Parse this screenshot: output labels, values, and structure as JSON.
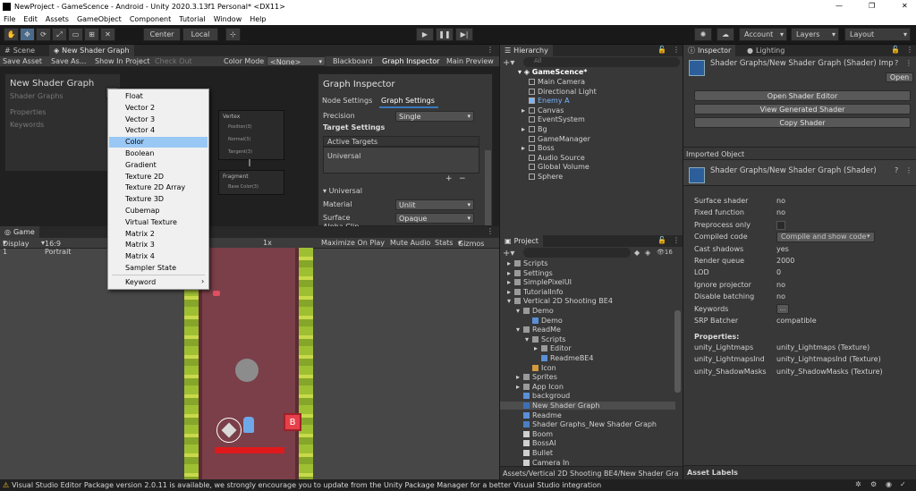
{
  "window": {
    "title": "NewProject - GameScence - Android - Unity 2020.3.13f1 Personal* <DX11>",
    "controls": [
      "—",
      "❐",
      "✕"
    ]
  },
  "menu": [
    "File",
    "Edit",
    "Assets",
    "GameObject",
    "Component",
    "Tutorial",
    "Window",
    "Help"
  ],
  "toolbar": {
    "center": "Center",
    "local": "Local",
    "account": "Account",
    "layers": "Layers",
    "layout": "Layout"
  },
  "scene_panel": {
    "tab_scene": "Scene",
    "tab_shader": "New Shader Graph",
    "subbar": {
      "save_asset": "Save Asset",
      "save_as": "Save As...",
      "show_in_project": "Show In Project",
      "check_out": "Check Out",
      "color_mode_label": "Color Mode",
      "color_mode_value": "<None>",
      "blackboard": "Blackboard",
      "graph_inspector": "Graph Inspector",
      "main_preview": "Main Preview"
    },
    "blackboard": {
      "title": "New Shader Graph",
      "subtitle": "Shader Graphs",
      "properties": "Properties",
      "keywords": "Keywords"
    },
    "nodes": {
      "vertex_title": "Vertex",
      "vertex_ports": [
        "Position(3)",
        "Normal(3)",
        "Tangent(3)"
      ],
      "fragment_title": "Fragment",
      "fragment_ports": [
        "Base Color(3)"
      ]
    },
    "graph_inspector": {
      "title": "Graph Inspector",
      "tab_node": "Node Settings",
      "tab_graph": "Graph Settings",
      "precision_label": "Precision",
      "precision_value": "Single",
      "target_settings": "Target Settings",
      "active_targets": "Active Targets",
      "universal_item": "Universal",
      "universal_section": "Universal",
      "material_label": "Material",
      "material_value": "Unlit",
      "surface_label": "Surface",
      "surface_value": "Opaque",
      "alpha_clip_label": "Alpha Clip"
    }
  },
  "context_menu": {
    "items": [
      "Float",
      "Vector 2",
      "Vector 3",
      "Vector 4",
      "Color",
      "Boolean",
      "Gradient",
      "Texture 2D",
      "Texture 2D Array",
      "Texture 3D",
      "Cubemap",
      "Virtual Texture",
      "Matrix 2",
      "Matrix 3",
      "Matrix 4",
      "Sampler State",
      "Keyword"
    ],
    "selected": "Color"
  },
  "game_panel": {
    "tab": "Game",
    "display": "Display 1",
    "aspect": "16:9 Portrait",
    "scale": "1x",
    "maximize": "Maximize On Play",
    "mute": "Mute Audio",
    "stats": "Stats",
    "gizmos": "Gizmos"
  },
  "hierarchy": {
    "tab": "Hierarchy",
    "search_placeholder": "All",
    "scene": "GameScence*",
    "items": [
      "Main Camera",
      "Directional Light",
      "Enemy A",
      "Canvas",
      "EventSystem",
      "Bg",
      "GameManager",
      "Boss",
      "Audio Source",
      "Global Volume",
      "Sphere"
    ]
  },
  "project": {
    "tab": "Project",
    "badge": "16",
    "items": [
      "Scripts",
      "Settings",
      "SimplePixelUI",
      "TutorialInfo",
      "Vertical 2D Shooting BE4",
      "Demo",
      "Demo",
      "ReadMe",
      "Scripts",
      "Editor",
      "ReadmeBE4",
      "Icon",
      "Sprites",
      "App Icon",
      "backgroud",
      "New Shader Graph",
      "Readme",
      "Shader Graphs_New Shader Graph",
      "Boom",
      "BossAI",
      "Bullet",
      "Camera In"
    ],
    "path": "Assets/Vertical 2D Shooting BE4/New Shader Gra"
  },
  "inspector": {
    "tab_inspector": "Inspector",
    "tab_lighting": "Lighting",
    "header": "Shader Graphs/New Shader Graph (Shader) Impc",
    "open": "Open",
    "open_shader_editor": "Open Shader Editor",
    "view_generated": "View Generated Shader",
    "copy_shader": "Copy Shader",
    "imported_object": "Imported Object",
    "object_title": "Shader Graphs/New Shader Graph (Shader)",
    "props": [
      {
        "label": "Surface shader",
        "value": "no"
      },
      {
        "label": "Fixed function",
        "value": "no"
      },
      {
        "label": "Preprocess only",
        "value": ""
      },
      {
        "label": "Compiled code",
        "value": "Compile and show code"
      },
      {
        "label": "Cast shadows",
        "value": "yes"
      },
      {
        "label": "Render queue",
        "value": "2000"
      },
      {
        "label": "LOD",
        "value": "0"
      },
      {
        "label": "Ignore projector",
        "value": "no"
      },
      {
        "label": "Disable batching",
        "value": "no"
      },
      {
        "label": "Keywords",
        "value": "..."
      },
      {
        "label": "SRP Batcher",
        "value": "compatible"
      }
    ],
    "properties_title": "Properties:",
    "properties": [
      {
        "label": "unity_Lightmaps",
        "value": "unity_Lightmaps (Texture)"
      },
      {
        "label": "unity_LightmapsInd",
        "value": "unity_LightmapsInd (Texture)"
      },
      {
        "label": "unity_ShadowMasks",
        "value": "unity_ShadowMasks (Texture)"
      }
    ],
    "asset_labels": "Asset Labels"
  },
  "status": {
    "message": "Visual Studio Editor Package version 2.0.11 is available, we strongly encourage you to update from the Unity Package Manager for a better Visual Studio integration"
  },
  "colors": {
    "accent_selection": "#99c8f5",
    "enemy_link": "#7ab4ff",
    "health_bar": "#e0191c",
    "grass": "#9fbf33",
    "road": "#7a3f48"
  }
}
